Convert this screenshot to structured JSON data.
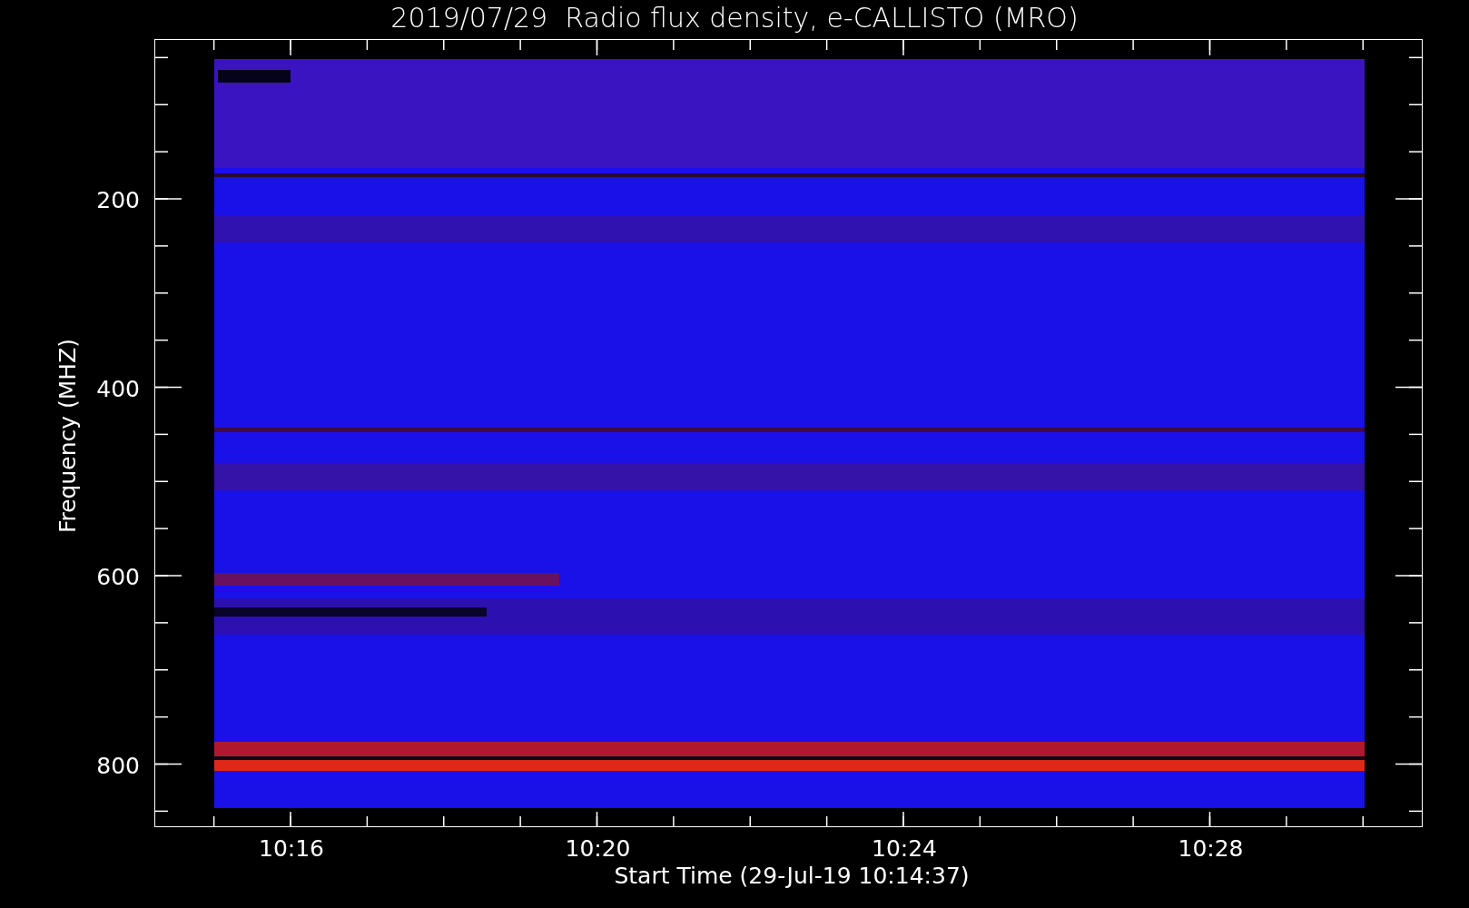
{
  "title": "2019/07/29  Radio flux density, e-CALLISTO (MRO)",
  "y_axis": {
    "label": "Frequency (MHZ)",
    "ticks": [
      "200",
      "400",
      "600",
      "800"
    ]
  },
  "x_axis": {
    "label": "Start Time (29-Jul-19 10:14:37)",
    "ticks": [
      "10:16",
      "10:20",
      "10:24",
      "10:28"
    ]
  }
}
